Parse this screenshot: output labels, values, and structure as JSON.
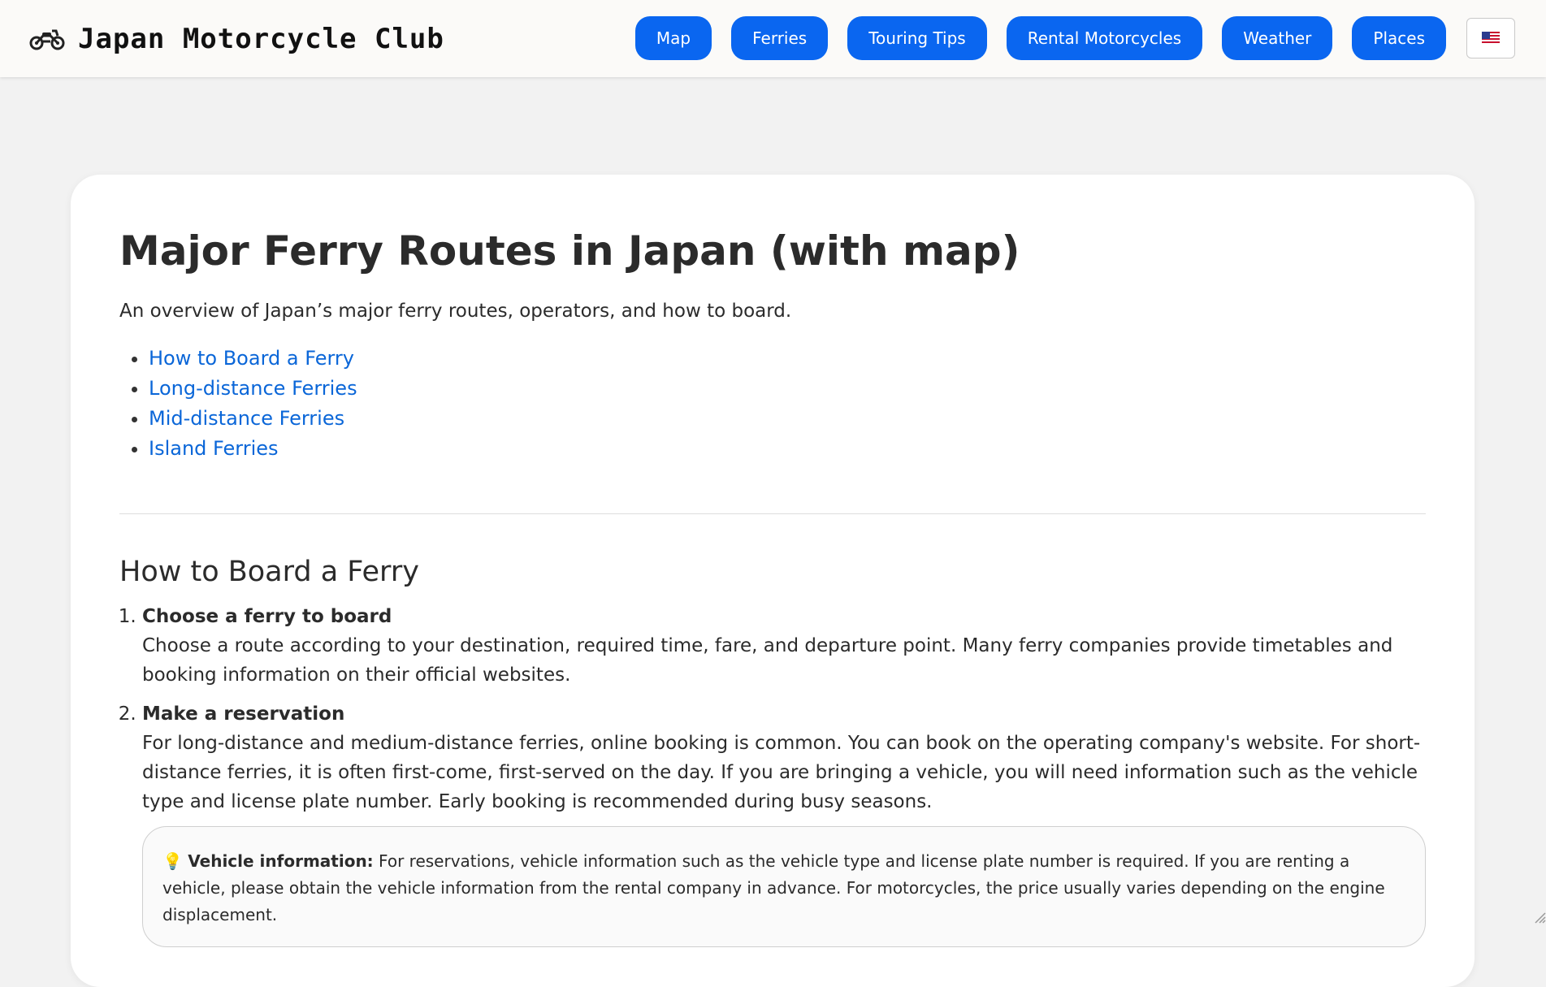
{
  "header": {
    "brand_title": "Japan Motorcycle Club",
    "brand_icon": "motorcycle-icon",
    "nav": [
      {
        "label": "Map"
      },
      {
        "label": "Ferries"
      },
      {
        "label": "Touring Tips"
      },
      {
        "label": "Rental Motorcycles"
      },
      {
        "label": "Weather"
      },
      {
        "label": "Places"
      }
    ],
    "language_icon": "us-flag-icon",
    "accent_color": "#0a66f0"
  },
  "article": {
    "title": "Major Ferry Routes in Japan (with map)",
    "intro": "An overview of Japan’s major ferry routes, operators, and how to board.",
    "toc": [
      {
        "label": "How to Board a Ferry"
      },
      {
        "label": "Long-distance Ferries"
      },
      {
        "label": "Mid-distance Ferries"
      },
      {
        "label": "Island Ferries"
      }
    ],
    "section_title": "How to Board a Ferry",
    "steps": [
      {
        "title": "Choose a ferry to board",
        "body": "Choose a route according to your destination, required time, fare, and departure point. Many ferry companies provide timetables and booking information on their official websites."
      },
      {
        "title": "Make a reservation",
        "body": "For long-distance and medium-distance ferries, online booking is common. You can book on the operating company's website. For short-distance ferries, it is often first-come, first-served on the day. If you are bringing a vehicle, you will need information such as the vehicle type and license plate number. Early booking is recommended during busy seasons."
      }
    ],
    "note": {
      "icon": "lightbulb-icon",
      "label": "Vehicle information:",
      "text": "For reservations, vehicle information such as the vehicle type and license plate number is required. If you are renting a vehicle, please obtain the vehicle information from the rental company in advance. For motorcycles, the price usually varies depending on the engine displacement."
    }
  }
}
